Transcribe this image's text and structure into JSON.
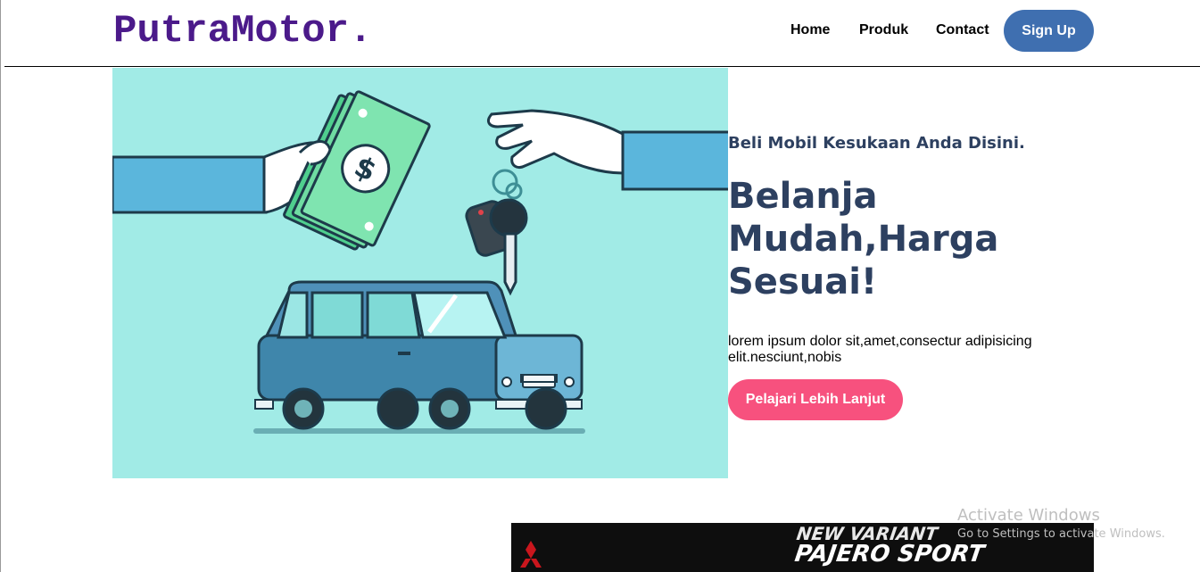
{
  "brand": {
    "logo": "PutraMotor."
  },
  "nav": {
    "home": "Home",
    "produk": "Produk",
    "contact": "Contact",
    "signup": "Sign Up"
  },
  "hero": {
    "tagline": "Beli Mobil Kesukaan Anda Disini.",
    "headline": "Belanja Mudah,Harga Sesuai!",
    "description": "lorem ipsum dolor sit,amet,consectur adipisicing elit.nesciunt,nobis",
    "cta": "Pelajari Lebih Lanjut",
    "illustration": "money-for-car-keys-illustration"
  },
  "banner": {
    "line1": "NEW VARIANT",
    "line2": "PAJERO SPORT"
  },
  "watermark": {
    "title": "Activate Windows",
    "subtitle": "Go to Settings to activate Windows."
  },
  "colors": {
    "brand": "#4b1a8a",
    "signup": "#3f6fb0",
    "cta": "#f7517e",
    "heading": "#2d4060",
    "hero_bg": "#a1ebe6"
  }
}
